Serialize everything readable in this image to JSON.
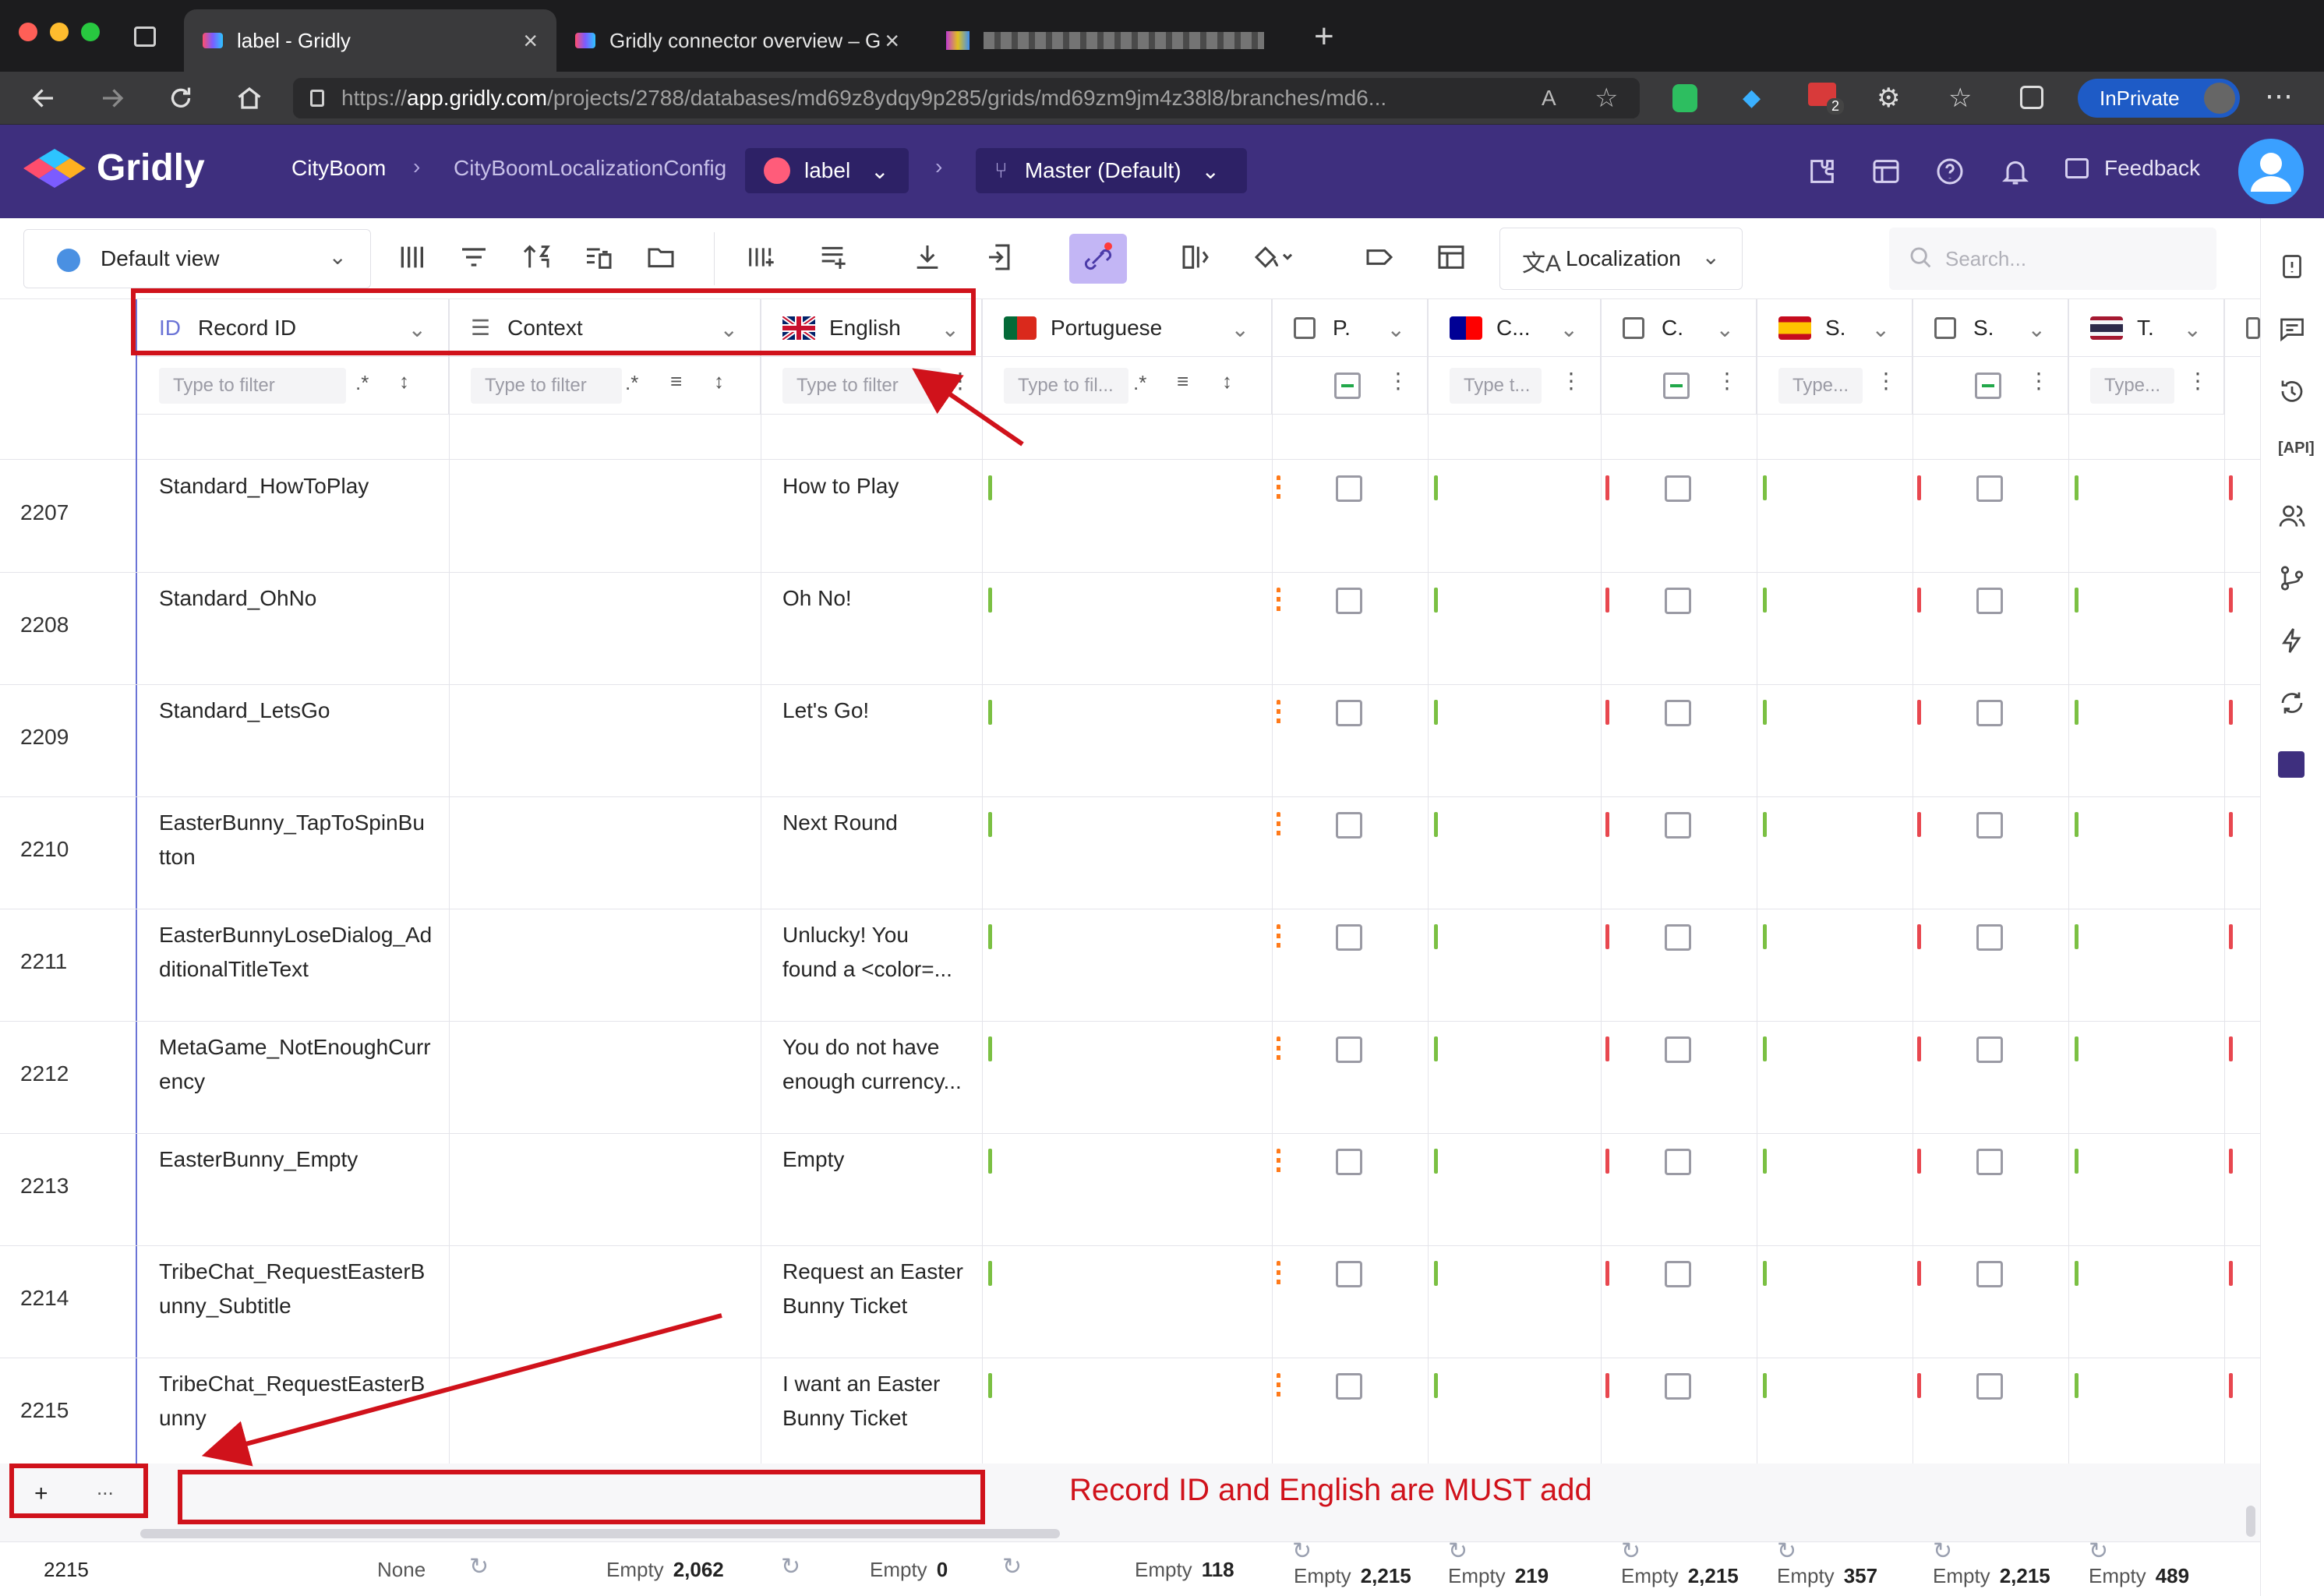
{
  "browser": {
    "tabs": [
      {
        "title": "label - Gridly",
        "active": true
      },
      {
        "title": "Gridly connector overview – G",
        "active": false
      }
    ],
    "url_domain": "app.gridly.com",
    "url_path": "/projects/2788/databases/md69z8ydqy9p285/grids/md69zm9jm4z38l8/branches/md6...",
    "url_prefix": "https://",
    "inprivate_label": "InPrivate",
    "extension_badge": "2"
  },
  "app": {
    "logo_text": "Gridly",
    "breadcrumb": {
      "project": "CityBoom",
      "database": "CityBoomLocalizationConfig",
      "grid": "label",
      "branch": "Master (Default)"
    },
    "feedback_label": "Feedback"
  },
  "toolbar": {
    "view_label": "Default view",
    "localization_label": "Localization",
    "search_placeholder": "Search..."
  },
  "columns": [
    {
      "key": "record_id",
      "icon": "ID",
      "label": "Record ID",
      "filter": "Type to filter"
    },
    {
      "key": "context",
      "label": "Context",
      "filter": "Type to filter"
    },
    {
      "key": "english",
      "label": "English",
      "filter": "Type to filter"
    },
    {
      "key": "portuguese",
      "label": "Portuguese",
      "filter": "Type to fil..."
    },
    {
      "key": "p_check",
      "label": "P."
    },
    {
      "key": "c_lang",
      "label": "C...",
      "filter": "Type t..."
    },
    {
      "key": "c_check",
      "label": "C."
    },
    {
      "key": "s_lang",
      "label": "S.",
      "filter": "Type..."
    },
    {
      "key": "s_check",
      "label": "S."
    },
    {
      "key": "t_lang",
      "label": "T.",
      "filter": "Type..."
    }
  ],
  "rows": [
    {
      "num": "2207",
      "record_id": [
        "Standard_HowToPlay"
      ],
      "english": [
        "How to Play"
      ]
    },
    {
      "num": "2208",
      "record_id": [
        "Standard_OhNo"
      ],
      "english": [
        "Oh No!"
      ]
    },
    {
      "num": "2209",
      "record_id": [
        "Standard_LetsGo"
      ],
      "english": [
        "Let's Go!"
      ]
    },
    {
      "num": "2210",
      "record_id": [
        "EasterBunny_TapToSpinBu",
        "tton"
      ],
      "english": [
        "Next Round"
      ]
    },
    {
      "num": "2211",
      "record_id": [
        "EasterBunnyLoseDialog_Ad",
        "ditionalTitleText"
      ],
      "english": [
        "Unlucky! You",
        "found a <color=..."
      ]
    },
    {
      "num": "2212",
      "record_id": [
        "MetaGame_NotEnoughCurr",
        "ency"
      ],
      "english": [
        "You do not have",
        "enough currency..."
      ]
    },
    {
      "num": "2213",
      "record_id": [
        "EasterBunny_Empty"
      ],
      "english": [
        "Empty"
      ]
    },
    {
      "num": "2214",
      "record_id": [
        "TribeChat_RequestEasterB",
        "unny_Subtitle"
      ],
      "english": [
        "Request an Easter",
        "Bunny Ticket"
      ]
    },
    {
      "num": "2215",
      "record_id": [
        "TribeChat_RequestEasterB",
        "unny"
      ],
      "english": [
        "I want an Easter",
        "Bunny Ticket"
      ]
    }
  ],
  "footer": {
    "add_label": "+",
    "more_label": "...",
    "row_count": "2215",
    "context_stat": "None",
    "stats": [
      {
        "label": "Empty",
        "value": "2,062"
      },
      {
        "label": "Empty",
        "value": "0"
      },
      {
        "label": "Empty",
        "value": "118"
      },
      {
        "label": "Empty",
        "value": "2,215"
      },
      {
        "label": "Empty",
        "value": "219"
      },
      {
        "label": "Empty",
        "value": "2,215"
      },
      {
        "label": "Empty",
        "value": "357"
      },
      {
        "label": "Empty",
        "value": "2,215"
      },
      {
        "label": "Empty",
        "value": "489"
      }
    ]
  },
  "annotation": {
    "note": "Record ID and English are MUST add",
    "color": "#d0121b"
  },
  "colors": {
    "header_bg": "#3e2f7e",
    "status_ok": "#7bc043",
    "status_missing": "#e8474f",
    "status_pending": "#ff7a1a"
  }
}
